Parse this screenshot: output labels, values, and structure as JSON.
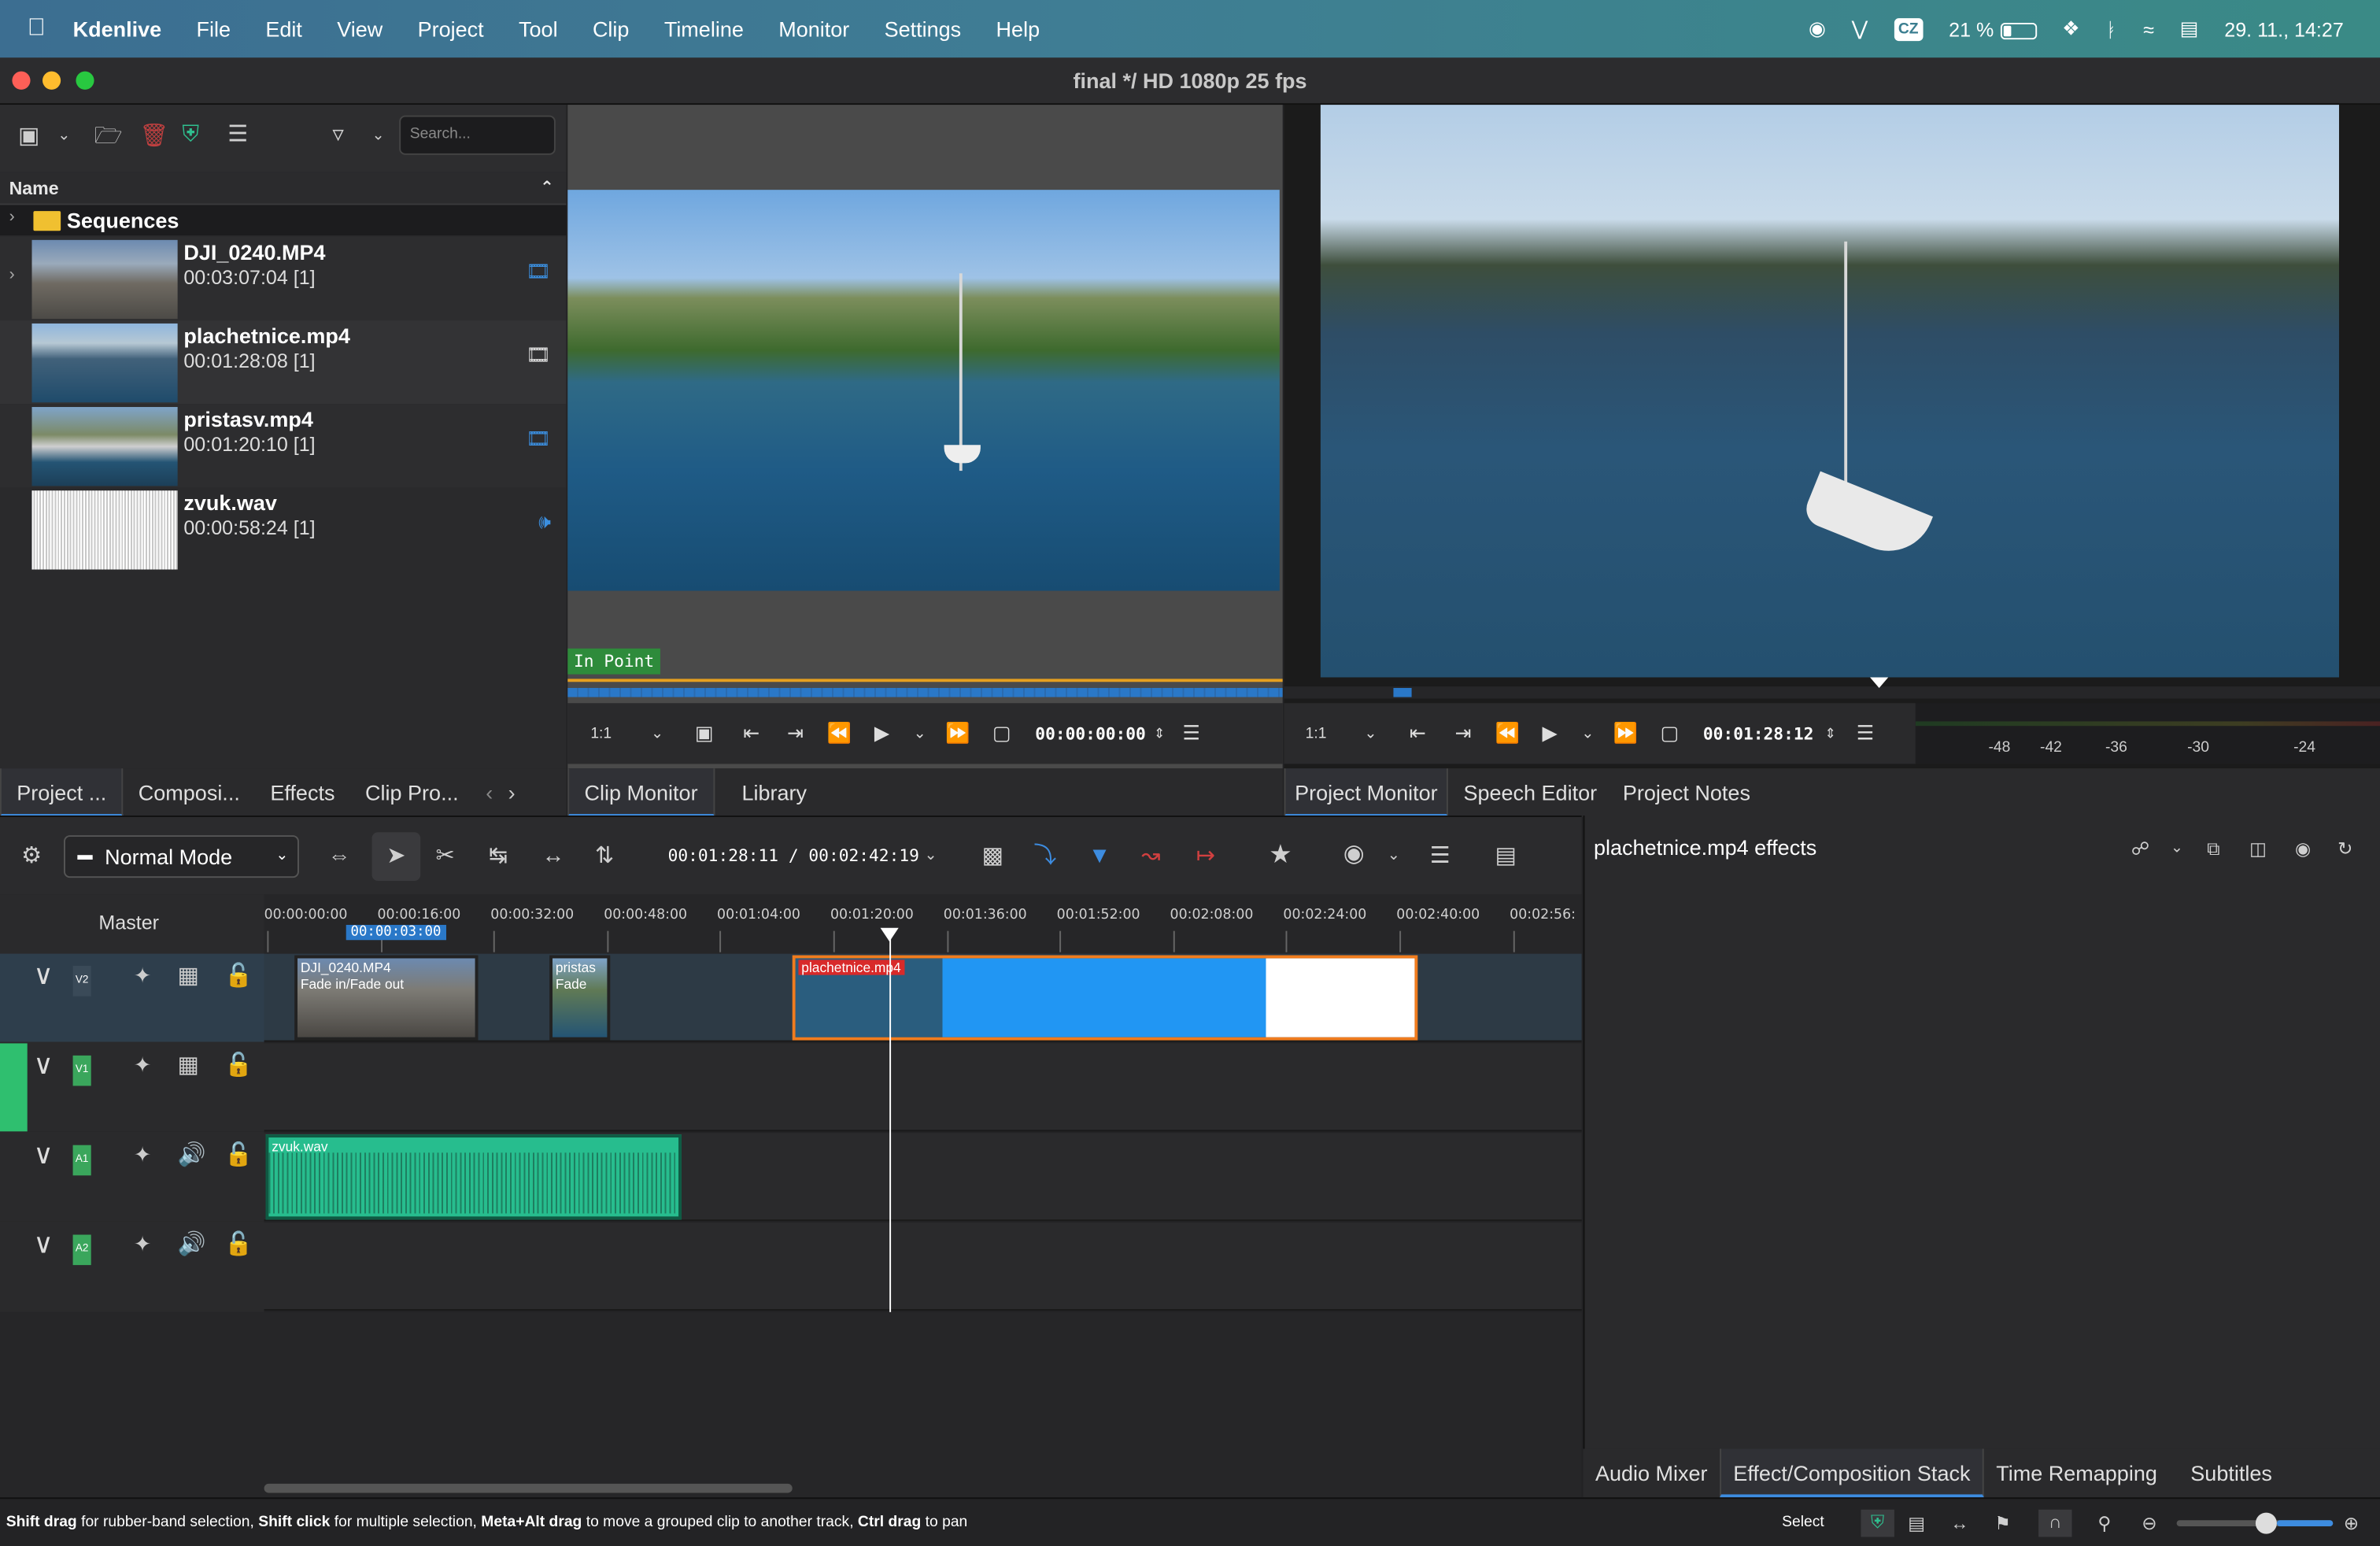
{
  "menubar": {
    "app": "Kdenlive",
    "items": [
      "File",
      "Edit",
      "View",
      "Project",
      "Tool",
      "Clip",
      "Timeline",
      "Monitor",
      "Settings",
      "Help"
    ],
    "keyboard": "CZ",
    "battery": "21 %",
    "datetime": "29. 11., 14:27"
  },
  "window": {
    "title": "final */ HD 1080p 25 fps"
  },
  "bin": {
    "search_placeholder": "Search...",
    "column": "Name",
    "folder": "Sequences",
    "items": [
      {
        "name": "DJI_0240.MP4",
        "duration": "00:03:07:04 [1]",
        "type": "video"
      },
      {
        "name": "plachetnice.mp4",
        "duration": "00:01:28:08 [1]",
        "type": "video"
      },
      {
        "name": "pristasv.mp4",
        "duration": "00:01:20:10 [1]",
        "type": "video"
      },
      {
        "name": "zvuk.wav",
        "duration": "00:00:58:24 [1]",
        "type": "audio"
      }
    ],
    "tabs": [
      "Project ...",
      "Composi...",
      "Effects",
      "Clip Pro..."
    ]
  },
  "clip_monitor": {
    "in_point": "In Point",
    "zoom": "1:1",
    "timecode": "00:00:00:00",
    "tabs": [
      "Clip Monitor",
      "Library"
    ]
  },
  "project_monitor": {
    "zoom": "1:1",
    "timecode": "00:01:28:12",
    "tabs": [
      "Project Monitor",
      "Speech Editor",
      "Project Notes"
    ],
    "meter_labels": [
      "-48",
      "-42",
      "-36",
      "-30",
      "-24"
    ]
  },
  "timeline": {
    "mode": "Normal Mode",
    "timecode": "00:01:28:11 / 00:02:42:19",
    "master": "Master",
    "guide": "00:00:03:00",
    "ruler": [
      "00:00:00:00",
      "00:00:16:00",
      "00:00:32:00",
      "00:00:48:00",
      "00:01:04:00",
      "00:01:20:00",
      "00:01:36:00",
      "00:01:52:00",
      "00:02:08:00",
      "00:02:24:00",
      "00:02:40:00",
      "00:02:56:"
    ],
    "tracks": [
      "V2",
      "V1",
      "A1",
      "A2"
    ],
    "clips": {
      "c1": "DJI_0240.MP4",
      "c1fx": "Fade in/Fade out",
      "c2": "pristas",
      "c2fx": "Fade",
      "c3": "plachetnice.mp4",
      "c4": "zvuk.wav"
    }
  },
  "effects": {
    "title": "plachetnice.mp4 effects",
    "tabs": [
      "Audio Mixer",
      "Effect/Composition Stack",
      "Time Remapping",
      "Subtitles"
    ]
  },
  "status": {
    "hint_parts": [
      "Shift drag",
      "for rubber-band selection,",
      "Shift click",
      "for multiple selection,",
      "Meta+Alt drag",
      "to move a grouped clip to another track,",
      "Ctrl drag",
      "to pan"
    ],
    "tool": "Select"
  }
}
